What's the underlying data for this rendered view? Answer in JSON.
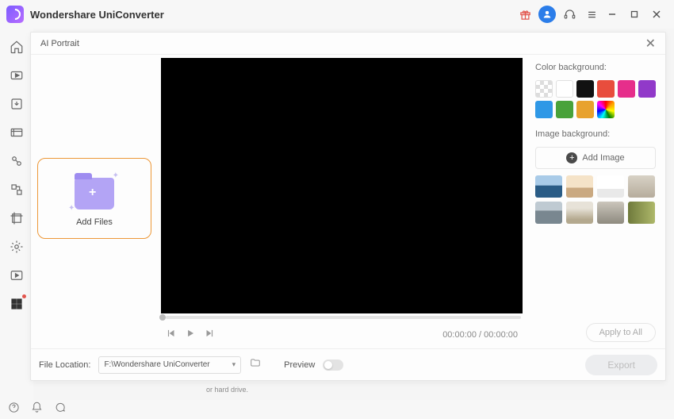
{
  "app": {
    "title": "Wondershare UniConverter"
  },
  "modal": {
    "title": "AI Portrait",
    "add_files_label": "Add Files",
    "color_bg_label": "Color background:",
    "image_bg_label": "Image background:",
    "add_image_label": "Add Image",
    "apply_all_label": "Apply to All",
    "time_display": "00:00:00 / 00:00:00",
    "colors": [
      "transparent",
      "#ffffff",
      "#111111",
      "#e84d3d",
      "#e62e8b",
      "#9139c9",
      "#2f98e6",
      "#49a23a",
      "#e8a22e",
      "rainbow"
    ],
    "thumbs": [
      "linear-gradient(180deg,#a9cbe8 45%,#2a5c86 46%)",
      "linear-gradient(180deg,#f5e3c8 55%,#caa981 56%)",
      "linear-gradient(180deg,#ffffff 60%,#e9e9e9 61%)",
      "linear-gradient(180deg,#d8d2c6 0%,#b6ac9c 100%)",
      "linear-gradient(180deg,#bfcad2 40%,#798790 41%)",
      "linear-gradient(180deg,#e7e2d8 30%,#b4a98f 80%)",
      "linear-gradient(180deg,#cbc6bc 0%,#8e8a7f 100%)",
      "linear-gradient(90deg,#6f7a3c 0%,#aeb86a 100%)"
    ]
  },
  "footer": {
    "file_location_label": "File Location:",
    "file_location_value": "F:\\Wondershare UniConverter",
    "preview_label": "Preview",
    "export_label": "Export"
  },
  "bg_snippets": {
    "a": "or hard drive."
  }
}
